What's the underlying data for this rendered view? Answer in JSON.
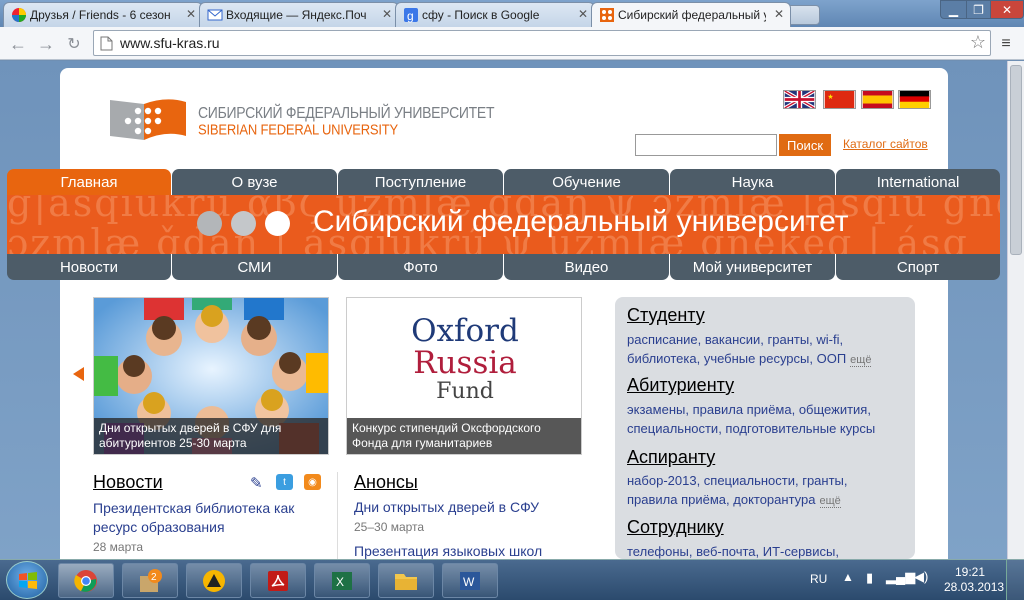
{
  "tabs": [
    {
      "label": "Друзья / Friends - 6 сезон",
      "icon": "colorful-circle-icon"
    },
    {
      "label": "Входящие — Яндекс.Почта",
      "icon": "mail-icon"
    },
    {
      "label": "сфу - Поиск в Google",
      "icon": "google-icon"
    },
    {
      "label": "Сибирский федеральный университет",
      "icon": "sfu-logo-icon"
    }
  ],
  "address": {
    "url": "www.sfu-kras.ru"
  },
  "site": {
    "logo_ru": "СИБИРСКИЙ ФЕДЕРАЛЬНЫЙ УНИВЕРСИТЕТ",
    "logo_en": "SIBERIAN FEDERAL UNIVERSITY",
    "search_button": "Поиск",
    "catalog_link": "Каталог сайтов",
    "nav_top": [
      "Главная",
      "О вузе",
      "Поступление",
      "Обучение",
      "Наука",
      "International"
    ],
    "nav_bottom": [
      "Новости",
      "СМИ",
      "Фото",
      "Видео",
      "Мой университет",
      "Спорт"
    ],
    "banner_title": "Сибирский федеральный университет",
    "banner_bg": "g|ásqìukrú αβζ ŭzmlæ ǧdaŋ ψ ɔzmlæ |ásqìu gnekeg kru",
    "banner_bg2": "ɔzmlæ ǧdaŋ | ásqìukrú ψ ŭzmlæ gnekeg | ásq",
    "photo1_caption": "Дни открытых дверей в СФУ для абитуриентов 25-30 марта",
    "oxford": {
      "line1": "Oxford",
      "line2": "Russia",
      "line3": "Fund"
    },
    "photo2_caption": "Конкурс стипендий Оксфордского Фонда для гуманитариев",
    "news_heading": "Новости",
    "news_item_title": "Президентская библиотека как ресурс образования",
    "news_item_date": "28 марта",
    "anons_heading": "Анонсы",
    "anons_item_title": "Дни открытых дверей в СФУ",
    "anons_item_date": "25–30 марта",
    "anons_item2_title": "Презентация языковых школ"
  },
  "panel": {
    "student": {
      "title": "Студенту",
      "line1": "расписание, вакансии, гранты, wi-fi,",
      "line2": "библиотека, учебные ресурсы, ООП",
      "more": "ещё"
    },
    "applicant": {
      "title": "Абитуриенту",
      "line1": "экзамены, правила приёма, общежития,",
      "line2": "специальности, подготовительные курсы"
    },
    "graduate": {
      "title": "Аспиранту",
      "line1": "набор-2013, специальности, гранты,",
      "line2": "правила приёма, докторантура",
      "more": "ещё"
    },
    "staff": {
      "title": "Сотруднику",
      "line1": "телефоны, веб-почта, ИТ-сервисы,"
    }
  },
  "taskbar": {
    "lang": "RU",
    "time": "19:21",
    "date": "28.03.2013"
  },
  "colors": {
    "accent": "#e8650f",
    "nav": "#4d5c68",
    "banner": "#ea5b1d",
    "link": "#2a3f8f"
  }
}
